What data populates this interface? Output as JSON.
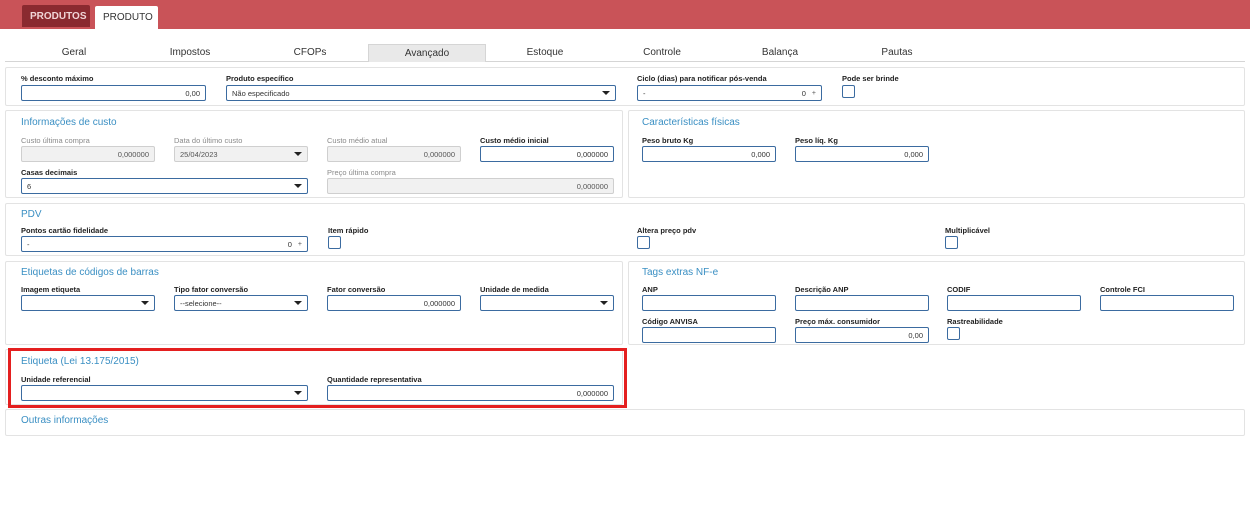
{
  "tabs": [
    {
      "label": "PRODUTOS"
    },
    {
      "label": "PRODUTO"
    }
  ],
  "nav": [
    "Geral",
    "Impostos",
    "CFOPs",
    "Avançado",
    "Estoque",
    "Controle",
    "Balança",
    "Pautas"
  ],
  "nav_active": "Avançado",
  "general": {
    "desconto_label": "% desconto máximo",
    "desconto_value": "0,00",
    "produto_especifico_label": "Produto específico",
    "produto_especifico_value": "Não especificado",
    "ciclo_label": "Ciclo (dias) para notificar pós-venda",
    "ciclo_value": "-",
    "ciclo_num": "0",
    "ciclo_spin": "+",
    "brinde_label": "Pode ser brinde"
  },
  "custo": {
    "title": "Informações de custo",
    "ultima_compra_label": "Custo última compra",
    "ultima_compra_value": "0,000000",
    "data_ultimo_label": "Data do último custo",
    "data_ultimo_value": "25/04/2023",
    "medio_atual_label": "Custo médio atual",
    "medio_atual_value": "0,000000",
    "medio_inicial_label": "Custo médio inicial",
    "medio_inicial_value": "0,000000",
    "casas_label": "Casas decimais",
    "casas_value": "6",
    "preco_ultima_label": "Preço última compra",
    "preco_ultima_value": "0,000000"
  },
  "fisicas": {
    "title": "Características físicas",
    "bruto_label": "Peso bruto Kg",
    "bruto_value": "0,000",
    "liq_label": "Peso líq. Kg",
    "liq_value": "0,000"
  },
  "pdv": {
    "title": "PDV",
    "pontos_label": "Pontos cartão fidelidade",
    "pontos_value": "-",
    "pontos_num": "0",
    "pontos_spin": "+",
    "item_rapido_label": "Item rápido",
    "altera_preco_label": "Altera preço pdv",
    "multiplicavel_label": "Multiplicável"
  },
  "etiquetas": {
    "title": "Etiquetas de códigos de barras",
    "imagem_label": "Imagem etiqueta",
    "tipo_label": "Tipo fator conversão",
    "tipo_value": "--selecione--",
    "fator_label": "Fator conversão",
    "fator_value": "0,000000",
    "unidade_label": "Unidade de medida"
  },
  "tags": {
    "title": "Tags extras NF-e",
    "anp_label": "ANP",
    "desc_anp_label": "Descrição ANP",
    "codif_label": "CODIF",
    "controle_fci_label": "Controle FCI",
    "anvisa_label": "Código ANVISA",
    "preco_max_label": "Preço máx. consumidor",
    "preco_max_value": "0,00",
    "rastreabilidade_label": "Rastreabilidade"
  },
  "lei": {
    "title": "Etiqueta (Lei 13.175/2015)",
    "unidade_ref_label": "Unidade referencial",
    "quantidade_label": "Quantidade representativa",
    "quantidade_value": "0,000000"
  },
  "outras": {
    "title": "Outras informações"
  },
  "colors": {
    "topbar": "#c95358",
    "section_title": "#3a8fc3",
    "highlight": "#e41f1f",
    "input_border": "#3b6ba0"
  }
}
